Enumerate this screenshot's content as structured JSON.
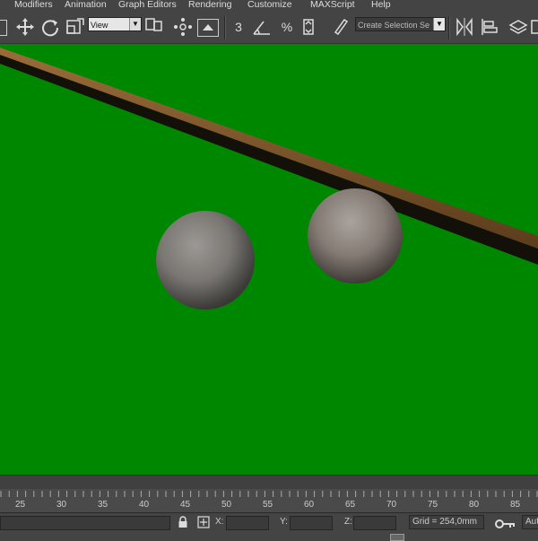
{
  "menu": [
    "Modifiers",
    "Animation",
    "Graph Editors",
    "Rendering",
    "Customize",
    "MAXScript",
    "Help"
  ],
  "toolbar": {
    "view_combo": "View",
    "selection_set_placeholder": "Create Selection Se",
    "snap_label": "3",
    "percent_label": "%"
  },
  "timeline": {
    "ticks": [
      "25",
      "30",
      "35",
      "40",
      "45",
      "50",
      "55",
      "60",
      "65",
      "70",
      "75",
      "80",
      "85"
    ]
  },
  "status": {
    "x_label": "X:",
    "y_label": "Y:",
    "z_label": "Z:",
    "grid_text": "Grid = 254,0mm",
    "auto_label": "Aut"
  },
  "colors": {
    "viewport_bg": "#008700",
    "cue_top": "#8a5a2b",
    "cue_shadow": "#1a1208",
    "ball": "#7e7b78"
  }
}
